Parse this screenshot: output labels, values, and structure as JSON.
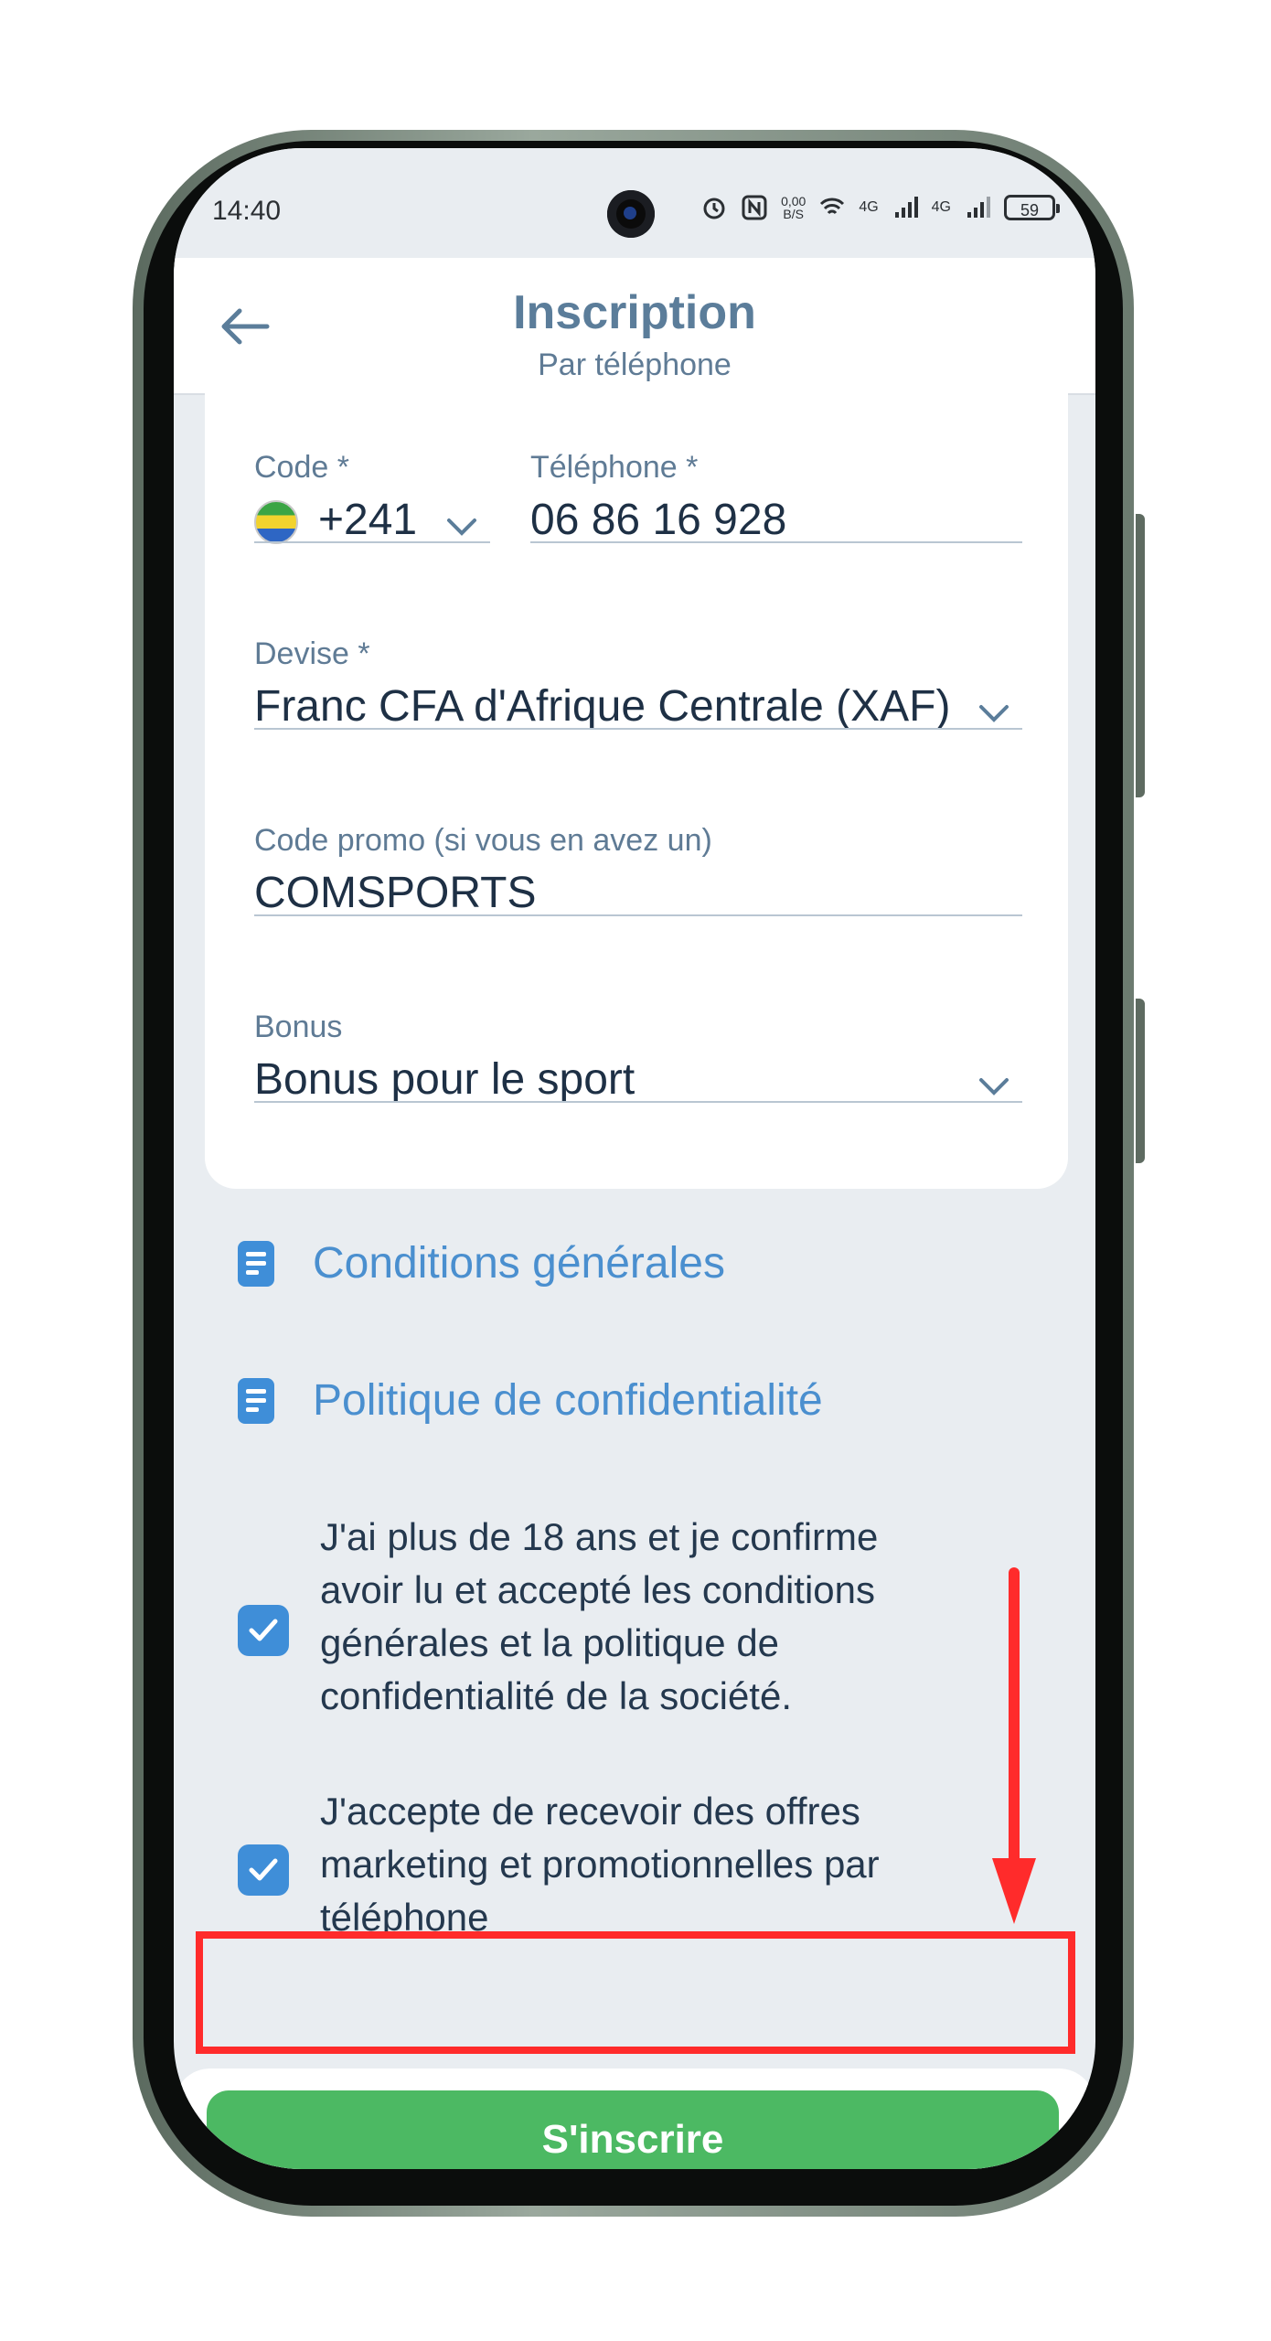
{
  "status_bar": {
    "time": "14:40",
    "net_speed_top": "0,00",
    "net_speed_bottom": "B/S",
    "signal1": "4G",
    "signal2": "4G",
    "battery": "59"
  },
  "header": {
    "title": "Inscription",
    "subtitle": "Par téléphone"
  },
  "form": {
    "code": {
      "label": "Code *",
      "value": "+241"
    },
    "phone": {
      "label": "Téléphone *",
      "value": "06 86 16 928"
    },
    "currency": {
      "label": "Devise *",
      "value": "Franc CFA d'Afrique Centrale (XAF)"
    },
    "promo": {
      "label": "Code promo (si vous en avez un)",
      "value": "COMSPORTS"
    },
    "bonus": {
      "label": "Bonus",
      "value": "Bonus pour le sport"
    }
  },
  "links": {
    "terms": "Conditions générales",
    "privacy": "Politique de confidentialité"
  },
  "checkboxes": {
    "age_confirm": "J'ai plus de 18 ans et je confirme avoir lu et accepté les conditions générales et la politique de confidentialité de la société.",
    "marketing": "J'accepte de recevoir des offres marketing et promotionnelles par téléphone"
  },
  "cta": {
    "label": "S'inscrire"
  },
  "colors": {
    "accent": "#4a8fcf",
    "cta": "#4cb963",
    "highlight": "#ff2b2b"
  }
}
